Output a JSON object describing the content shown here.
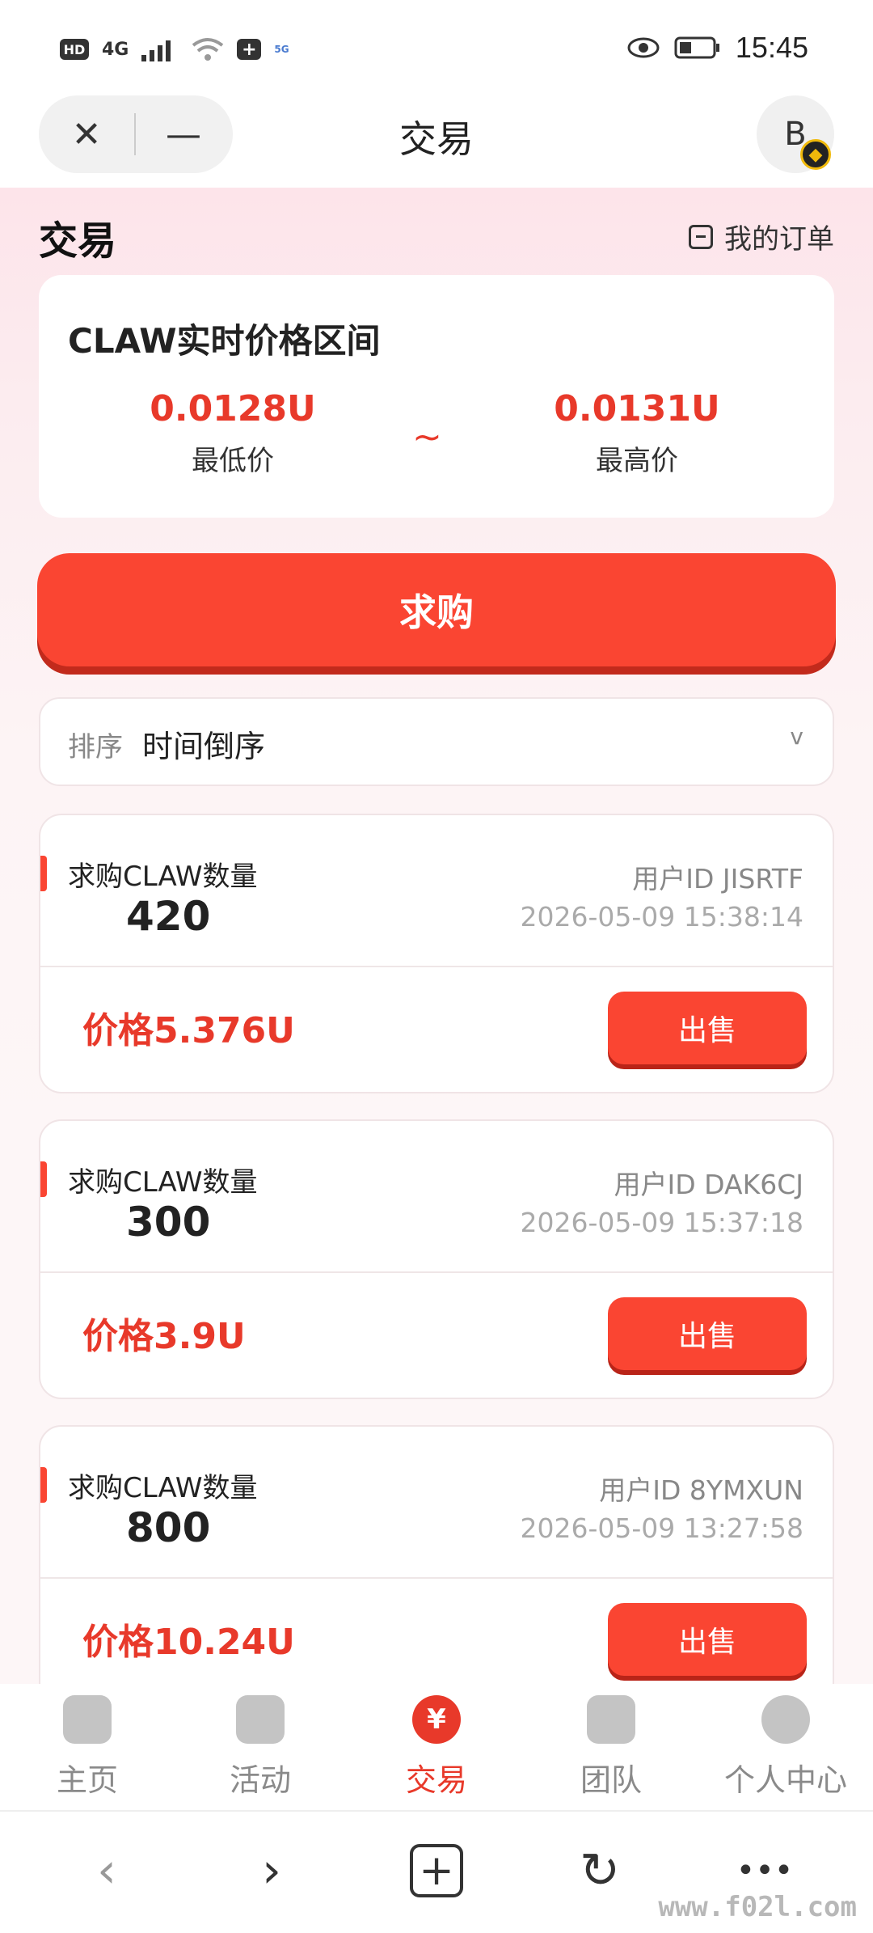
{
  "status_bar": {
    "left_labels": [
      "HD",
      "4G",
      "5G"
    ],
    "time": "15:45"
  },
  "header": {
    "title": "交易",
    "close_glyph": "✕",
    "minimize_glyph": "—",
    "avatar_letter": "B"
  },
  "page": {
    "title": "交易",
    "my_orders": "我的订单"
  },
  "price_range": {
    "title": "CLAW实时价格区间",
    "low_value": "0.0128U",
    "low_label": "最低价",
    "separator": "~",
    "high_value": "0.0131U",
    "high_label": "最高价"
  },
  "buy_button": "求购",
  "sort": {
    "label": "排序",
    "value": "时间倒序",
    "chevron": "v"
  },
  "orders": [
    {
      "label": "求购CLAW数量",
      "qty": "420",
      "user": "用户ID JISRTF",
      "time": "2026-05-09 15:38:14",
      "price": "价格5.376U",
      "action": "出售"
    },
    {
      "label": "求购CLAW数量",
      "qty": "300",
      "user": "用户ID DAK6CJ",
      "time": "2026-05-09 15:37:18",
      "price": "价格3.9U",
      "action": "出售"
    },
    {
      "label": "求购CLAW数量",
      "qty": "800",
      "user": "用户ID 8YMXUN",
      "time": "2026-05-09 13:27:58",
      "price": "价格10.24U",
      "action": "出售"
    }
  ],
  "tabs": [
    {
      "label": "主页",
      "icon": "home-icon"
    },
    {
      "label": "活动",
      "icon": "gift-icon"
    },
    {
      "label": "交易",
      "icon": "yen-icon",
      "glyph": "¥"
    },
    {
      "label": "团队",
      "icon": "team-icon"
    },
    {
      "label": "个人中心",
      "icon": "profile-icon"
    }
  ],
  "browser": {
    "back": "‹",
    "forward": "›",
    "new_tab": "+",
    "refresh": "↻",
    "more": "•••"
  },
  "watermark": "www.f02l.com",
  "colors": {
    "accent": "#fa4532",
    "price_red": "#e8392a",
    "page_bg": "#fdf4f5"
  }
}
